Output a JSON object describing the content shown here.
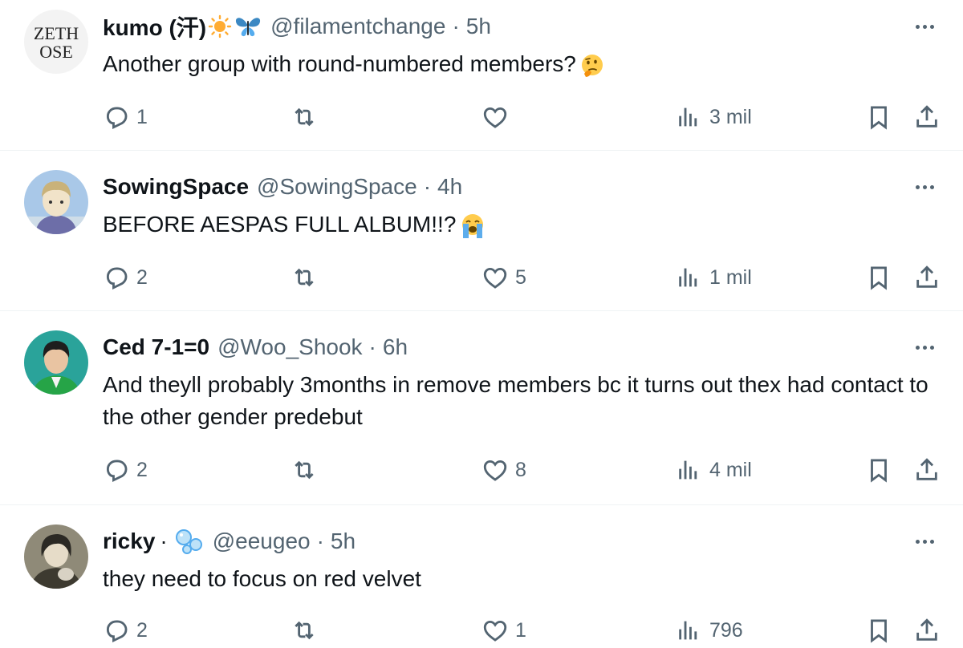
{
  "tweets": [
    {
      "name": "kumo (汗)",
      "name_emoji": [
        "sun-emoji",
        "butterfly-emoji"
      ],
      "handle": "@filamentchange",
      "separator": "·",
      "time": "5h",
      "text": "Another group with round-numbered members?",
      "text_emoji": "thinking-face-emoji",
      "avatar_text": "ZETH OSE",
      "stats": {
        "replies": "1",
        "retweets": "",
        "likes": "",
        "views": "3 mil"
      }
    },
    {
      "name": "SowingSpace",
      "handle": "@SowingSpace",
      "separator": "·",
      "time": "4h",
      "text": "BEFORE AESPAS FULL ALBUM!!?",
      "text_emoji": "loudly-crying-face-emoji",
      "stats": {
        "replies": "2",
        "retweets": "",
        "likes": "5",
        "views": "1 mil"
      }
    },
    {
      "name": "Ced 7-1=0",
      "handle": "@Woo_Shook",
      "separator": "·",
      "time": "6h",
      "text": "And theyll probably 3months in remove members bc it turns out thex had contact to the other gender predebut",
      "stats": {
        "replies": "2",
        "retweets": "",
        "likes": "8",
        "views": "4 mil"
      }
    },
    {
      "name": "ricky",
      "name_suffix": "·",
      "name_emoji": [
        "bubbles-emoji"
      ],
      "handle": "@eeugeo",
      "separator": "·",
      "time": "5h",
      "text": "they need to focus on red velvet",
      "stats": {
        "replies": "2",
        "retweets": "",
        "likes": "1",
        "views": "796"
      }
    }
  ],
  "colors": {
    "text": "#0f1419",
    "secondary": "#536471",
    "divider": "#eff3f4"
  },
  "icons": [
    "reply-icon",
    "retweet-icon",
    "like-icon",
    "views-icon",
    "bookmark-icon",
    "share-icon",
    "more-icon"
  ]
}
